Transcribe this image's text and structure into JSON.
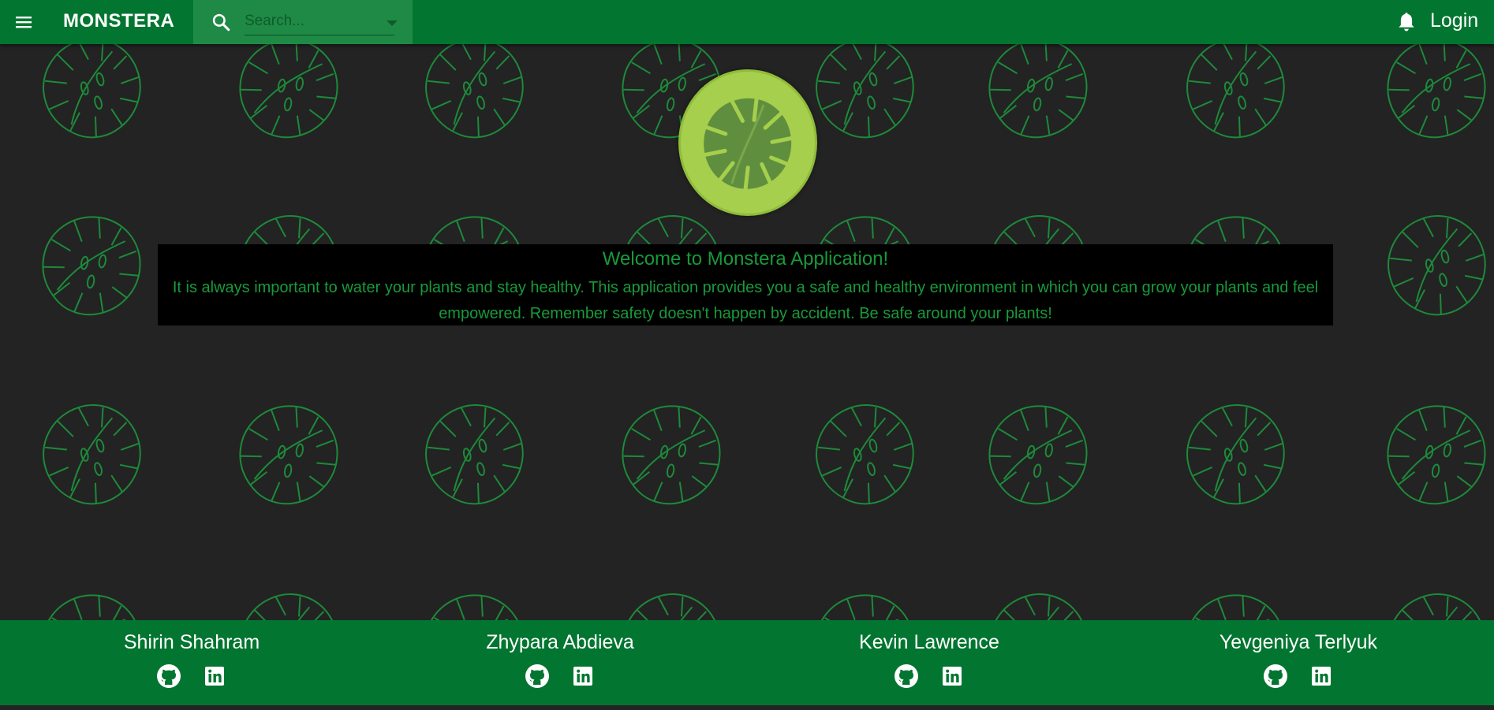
{
  "header": {
    "brand": "MONSTERA",
    "search_placeholder": "Search...",
    "login_label": "Login"
  },
  "hero": {
    "title": "Welcome to Monstera Application!",
    "text": "It is always important to water your plants and stay healthy. This application provides you a safe and healthy environment in which you can grow your plants and feel empowered. Remember safety doesn't happen by accident. Be safe around your plants!"
  },
  "footer": {
    "members": [
      {
        "name": "Shirin Shahram"
      },
      {
        "name": "Zhypara Abdieva"
      },
      {
        "name": "Kevin Lawrence"
      },
      {
        "name": "Yevgeniya Terlyuk"
      }
    ]
  },
  "colors": {
    "appbar": "#027630",
    "search_bg": "#1f8a45",
    "background": "#232323",
    "leaf_outline": "#1d8a3a",
    "welcome_text": "#189a39",
    "logo_circle": "#a5cf4c",
    "logo_leaf": "#5f8f3e"
  },
  "icons": {
    "menu": "menu-icon",
    "search": "search-icon",
    "notifications": "bell-icon",
    "github": "github-icon",
    "linkedin": "linkedin-icon",
    "logo": "monstera-leaf-icon"
  }
}
